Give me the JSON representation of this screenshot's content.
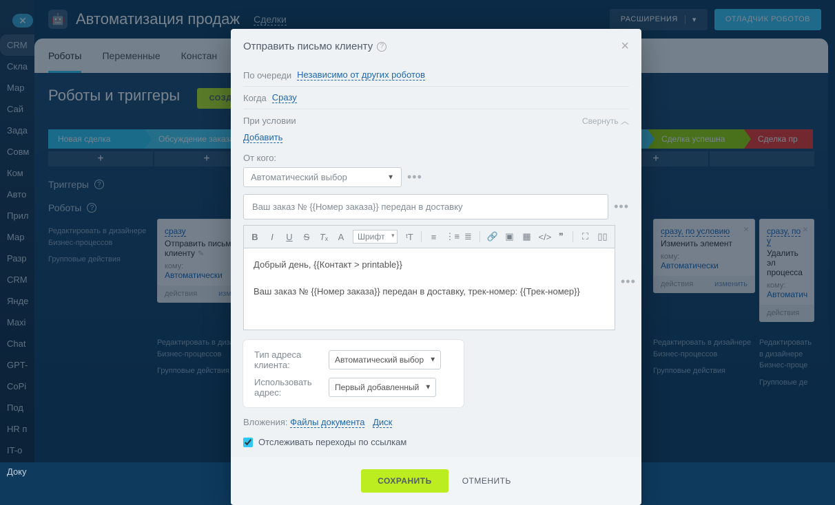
{
  "sidebar": {
    "items": [
      "CRM",
      "Скла",
      "Мар",
      "Сай",
      "Зада",
      "Совм",
      "Ком",
      "Авто",
      "Прил",
      "Мар",
      "Разр",
      "CRM",
      "Янде",
      "Maxi",
      "Chat",
      "GPT-",
      "CoPi",
      "Под",
      "HR п",
      "IT-о",
      "Доку"
    ]
  },
  "topbar": {
    "title": "Автоматизация продаж",
    "sub": "Сделки",
    "ext": "РАСШИРЕНИЯ",
    "debug": "ОТЛАДЧИК РОБОТОВ"
  },
  "tabs": {
    "t1": "Роботы",
    "t2": "Переменные",
    "t3": "Констан"
  },
  "section": {
    "title": "Роботы и триггеры",
    "create": "СОЗДАТЬ"
  },
  "stages": {
    "s1": "Новая сделка",
    "s2": "Обсуждение заказа",
    "s3": "Сделка успешна",
    "s4": "Сделка пр"
  },
  "sub1": "Триггеры",
  "sub2": "Роботы",
  "smallLinks": {
    "l1": "Редактировать в дизайнере",
    "l2": "Бизнес-процессов",
    "l3": "Групповые действия"
  },
  "card": {
    "trig": "сразу",
    "trig2": "сразу, по условию",
    "trig3": "сразу, по у",
    "title1": "Отправить письмо клиенту",
    "title2": "Изменить элемент",
    "title3": "Удалить эл\nпроцесса",
    "komu": "кому:",
    "auto": "Автоматически",
    "auto3": "Автоматич",
    "act": "действия",
    "edit": "изменить"
  },
  "modal": {
    "title": "Отправить письмо клиенту",
    "queueLabel": "По очереди",
    "queueVal": "Независимо от других роботов",
    "whenLabel": "Когда",
    "whenVal": "Сразу",
    "condLabel": "При условии",
    "collapse": "Свернуть",
    "add": "Добавить",
    "fromLabel": "От кого:",
    "fromVal": "Автоматический выбор",
    "subject": "Ваш заказ № {{Номер заказа}} передан в доставку",
    "fontSel": "Шрифт",
    "body1": "Добрый день, {{Контакт > printable}}",
    "body2": "Ваш заказ № {{Номер заказа}} передан в доставку, трек-номер: {{Трек-номер}}",
    "addrTypeLabel": "Тип адреса клиента:",
    "addrTypeVal": "Автоматический выбор",
    "useAddrLabel": "Использовать адрес:",
    "useAddrVal": "Первый добавленный",
    "attachLabel": "Вложения:",
    "attachDoc": "Файлы документа",
    "attachDisk": "Диск",
    "track": "Отслеживать переходы по ссылкам",
    "save": "СОХРАНИТЬ",
    "cancel": "ОТМЕНИТЬ"
  }
}
